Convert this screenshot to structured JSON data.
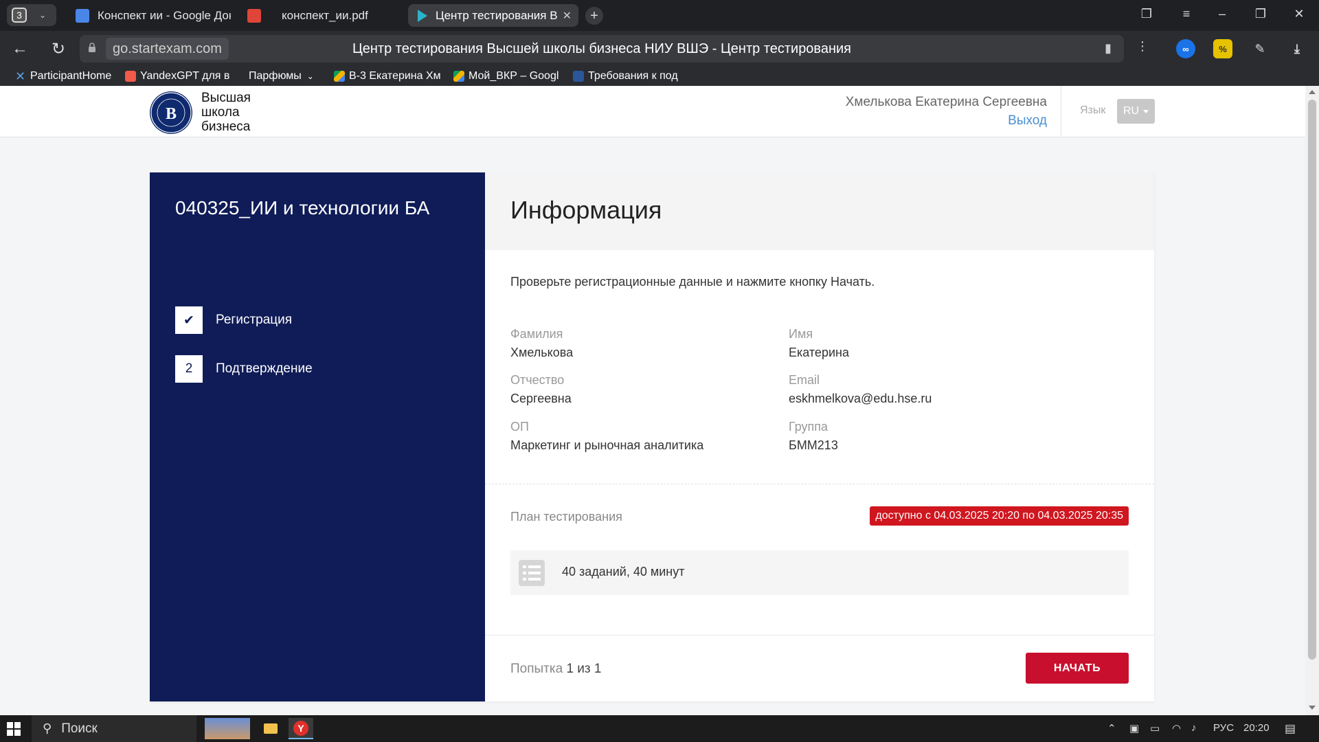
{
  "browser": {
    "tab_count": "3",
    "tabs": [
      {
        "title": "Конспект ии - Google Док",
        "icon": "google-docs-icon"
      },
      {
        "title": "конспект_ии.pdf",
        "icon": "pdf-icon"
      },
      {
        "title": "Центр тестирования В",
        "icon": "startexam-icon"
      }
    ],
    "url_domain": "go.startexam.com",
    "page_title": "Центр тестирования Высшей школы бизнеса НИУ ВШЭ - Центр тестирования",
    "bookmarks": [
      {
        "label": "ParticipantHome",
        "icon": "participant-icon"
      },
      {
        "label": "YandexGPT для в",
        "icon": "yandexgpt-icon"
      },
      {
        "label": "Парфюмы",
        "icon": "folder-icon"
      },
      {
        "label": "В-3 Екатерина Хм",
        "icon": "google-drive-icon"
      },
      {
        "label": "Мой_ВКР – Googl",
        "icon": "google-drive-icon"
      },
      {
        "label": "Требования к под",
        "icon": "word-icon"
      }
    ],
    "colors": {
      "chrome_dark": "#1f2023",
      "tab_active": "#3d3e42"
    }
  },
  "header": {
    "logo_lines": [
      "Высшая",
      "школа",
      "бизнеса"
    ],
    "user_name": "Хмелькова Екатерина Сергеевна",
    "logout": "Выход",
    "lang_label": "Язык",
    "lang_value": "RU"
  },
  "sidebar": {
    "exam_title": "040325_ИИ и технологии БА",
    "steps": [
      {
        "marker": "✔",
        "label": "Регистрация"
      },
      {
        "marker": "2",
        "label": "Подтверждение"
      }
    ],
    "color": "#0f1c57"
  },
  "main": {
    "heading": "Информация",
    "instruction": "Проверьте регистрационные данные и нажмите кнопку Начать.",
    "fields": [
      {
        "label": "Фамилия",
        "value": "Хмелькова"
      },
      {
        "label": "Имя",
        "value": "Екатерина"
      },
      {
        "label": "Отчество",
        "value": "Сергеевна"
      },
      {
        "label": "Email",
        "value": "eskhmelkova@edu.hse.ru"
      },
      {
        "label": "ОП",
        "value": "Маркетинг и рыночная аналитика"
      },
      {
        "label": "Группа",
        "value": "БММ213"
      }
    ],
    "plan_label": "План тестирования",
    "availability": "доступно с 04.03.2025 20:20 по 04.03.2025 20:35",
    "plan_summary": "40 заданий, 40 минут",
    "attempt_prefix": "Попытка",
    "attempt_current": "1 из 1",
    "start_button": "НАЧАТЬ",
    "accent": "#c8102e",
    "badge_color": "#d0161f"
  },
  "taskbar": {
    "search": "Поиск",
    "lang": "РУС",
    "time": "20:20"
  }
}
